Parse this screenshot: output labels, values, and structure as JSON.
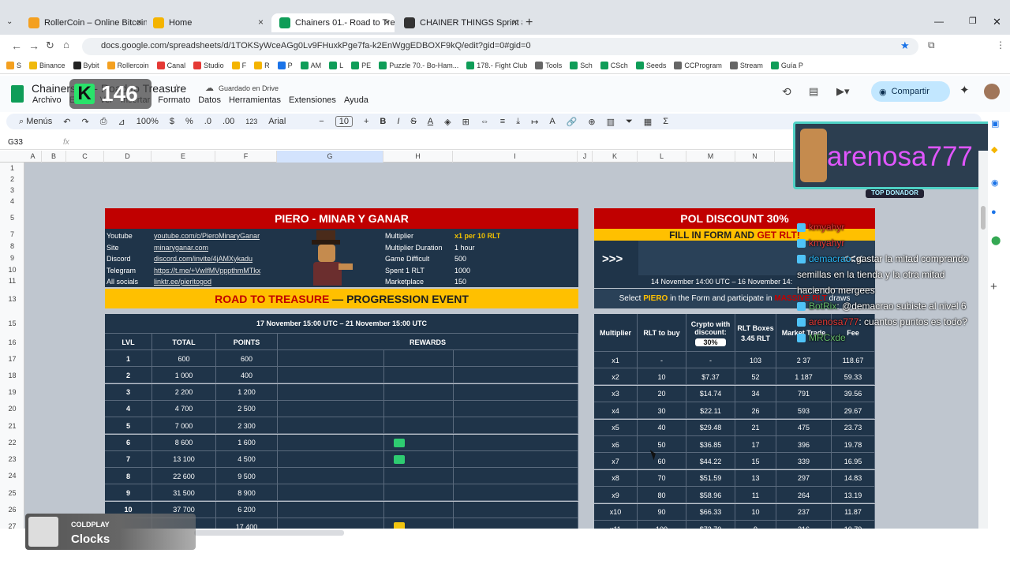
{
  "tabs": [
    {
      "label": "RollerCoin – Online Bitcoin Mi",
      "color": "#f4a020"
    },
    {
      "label": "Home",
      "color": "#f4b400"
    },
    {
      "label": "Chainers 01.- Road to Treasure",
      "color": "#0f9d58",
      "active": true
    },
    {
      "label": "CHAINER THINGS Sprint #24 S",
      "color": "#333333"
    }
  ],
  "url": "docs.google.com/spreadsheets/d/1TOKSyWceAGg0Lv9FHuxkPge7fa-k2EnWggEDBOXF9kQ/edit?gid=0#gid=0",
  "bookmarks": [
    "S",
    "Binance",
    "Bybit",
    "Rollercoin",
    "Canal",
    "Studio",
    "F",
    "R",
    "P",
    "AM",
    "L",
    "PE",
    "Puzzle 70.- Bo-Ham...",
    "178.- Fight Club",
    "Tools",
    "Sch",
    "CSch",
    "Seeds",
    "CCProgram",
    "Stream",
    "Guía P"
  ],
  "doc": {
    "title": "Chainers 01.- Road to Treasure",
    "saved": "Guardado en Drive",
    "menu": [
      "Archivo",
      "Editar",
      "Ver",
      "Insertar",
      "Formato",
      "Datos",
      "Herramientas",
      "Extensiones",
      "Ayuda"
    ],
    "share": "Compartir",
    "overlay_number": "146"
  },
  "toolbar": {
    "menus": "Menús",
    "zoom": "100%",
    "currency": "$",
    "percent": "%",
    "dec_less": ".0",
    "dec_more": ".00",
    "number": "123",
    "font": "Arial",
    "fontsize": "10"
  },
  "formula": {
    "cellref": "G33",
    "fx": "fx"
  },
  "columns": [
    "A",
    "B",
    "C",
    "D",
    "E",
    "F",
    "G",
    "H",
    "I",
    "J",
    "K",
    "L",
    "M",
    "N"
  ],
  "rows": [
    "1",
    "2",
    "3",
    "4",
    "5",
    "7",
    "8",
    "9",
    "10",
    "11",
    "13",
    "15",
    "16",
    "17",
    "18",
    "19",
    "20",
    "21",
    "22",
    "23",
    "24",
    "25",
    "26",
    "27"
  ],
  "left": {
    "title": "PIERO - MINAR Y GANAR",
    "info": [
      {
        "k": "Youtube",
        "v": "youtube.com/c/PieroMinaryGanar"
      },
      {
        "k": "Site",
        "v": "minaryganar.com"
      },
      {
        "k": "Discord",
        "v": "discord.com/invite/4jAMXykadu"
      },
      {
        "k": "Telegram",
        "v": "https://t.me/+VwIfMVpppthmMTkx"
      },
      {
        "k": "All socials",
        "v": "linktr.ee/pieritogod"
      }
    ],
    "stats": [
      {
        "k": "Multiplier",
        "v": "x1 per 10 RLT"
      },
      {
        "k": "Multiplier Duration",
        "v": "1 hour"
      },
      {
        "k": "Game Difficult",
        "v": "500"
      },
      {
        "k": "Spent 1 RLT",
        "v": "1000"
      },
      {
        "k": "Marketplace",
        "v": "150"
      }
    ],
    "event_red": "ROAD TO TREASURE",
    "event_rest": " — PROGRESSION EVENT",
    "dates": "17 November 15:00 UTC – 21 November 15:00 UTC",
    "headers": [
      "LVL",
      "TOTAL",
      "POINTS",
      "REWARDS"
    ],
    "rows": [
      [
        "1",
        "600",
        "600"
      ],
      [
        "2",
        "1 000",
        "400"
      ],
      [
        "3",
        "2 200",
        "1 200"
      ],
      [
        "4",
        "4 700",
        "2 500"
      ],
      [
        "5",
        "7 000",
        "2 300"
      ],
      [
        "6",
        "8 600",
        "1 600"
      ],
      [
        "7",
        "13 100",
        "4 500"
      ],
      [
        "8",
        "22 600",
        "9 500"
      ],
      [
        "9",
        "31 500",
        "8 900"
      ],
      [
        "10",
        "37 700",
        "6 200"
      ],
      [
        "",
        "",
        "17 400"
      ]
    ]
  },
  "right": {
    "title": "POL DISCOUNT 30%",
    "sub_a": "FILL IN FORM AND ",
    "sub_b": "GET RLT!",
    "arrows_l": ">>>",
    "arrows_r": "<<<",
    "dates": "14 November 14:00 UTC – 16 November 14:",
    "select_a": "Select ",
    "select_b": "PIERO",
    "select_c": " in the Form and participate in ",
    "select_d": "MASSIVE RLT",
    "select_e": " draws",
    "headers": [
      "Multiplier",
      "RLT to buy",
      "Crypto with discount:",
      "RLT Boxes",
      "Market Trade",
      "Fee"
    ],
    "discount": "30%",
    "boxes_price": "3.45 RLT",
    "rows": [
      [
        "x1",
        "-",
        "-",
        "103",
        "2 37",
        "118.67"
      ],
      [
        "x2",
        "10",
        "$7.37",
        "52",
        "1 187",
        "59.33"
      ],
      [
        "x3",
        "20",
        "$14.74",
        "34",
        "791",
        "39.56"
      ],
      [
        "x4",
        "30",
        "$22.11",
        "26",
        "593",
        "29.67"
      ],
      [
        "x5",
        "40",
        "$29.48",
        "21",
        "475",
        "23.73"
      ],
      [
        "x6",
        "50",
        "$36.85",
        "17",
        "396",
        "19.78"
      ],
      [
        "x7",
        "60",
        "$44.22",
        "15",
        "339",
        "16.95"
      ],
      [
        "x8",
        "70",
        "$51.59",
        "13",
        "297",
        "14.83"
      ],
      [
        "x9",
        "80",
        "$58.96",
        "11",
        "264",
        "13.19"
      ],
      [
        "x10",
        "90",
        "$66.33",
        "10",
        "237",
        "11.87"
      ],
      [
        "x11",
        "100",
        "$73.70",
        "9",
        "216",
        "10.79"
      ]
    ]
  },
  "stream": {
    "donor_name": "arenosa777",
    "donor_badge": "TOP DONADOR",
    "chat": [
      {
        "user": "kmyahyr",
        "text": ""
      },
      {
        "user": "kmyahyr",
        "text": ""
      },
      {
        "user": "demacrao",
        "text": ": gastar la mitad comprando semillas en la tienda y la otra mitad haciendo mergees"
      },
      {
        "user": "BotRix",
        "text": ": @demacrao subiste al nivel 6"
      },
      {
        "user": "arenosa777",
        "text": ": cuantos puntos es todo?"
      },
      {
        "user": "MRCxde",
        "text": ""
      }
    ],
    "music_artist": "COLDPLAY",
    "music_track": "Clocks"
  },
  "colors": {
    "red": "#c00000",
    "yellow": "#ffc000",
    "navy": "#1f3449",
    "grid": "#bfc6cf",
    "green": "#0f9d58"
  }
}
